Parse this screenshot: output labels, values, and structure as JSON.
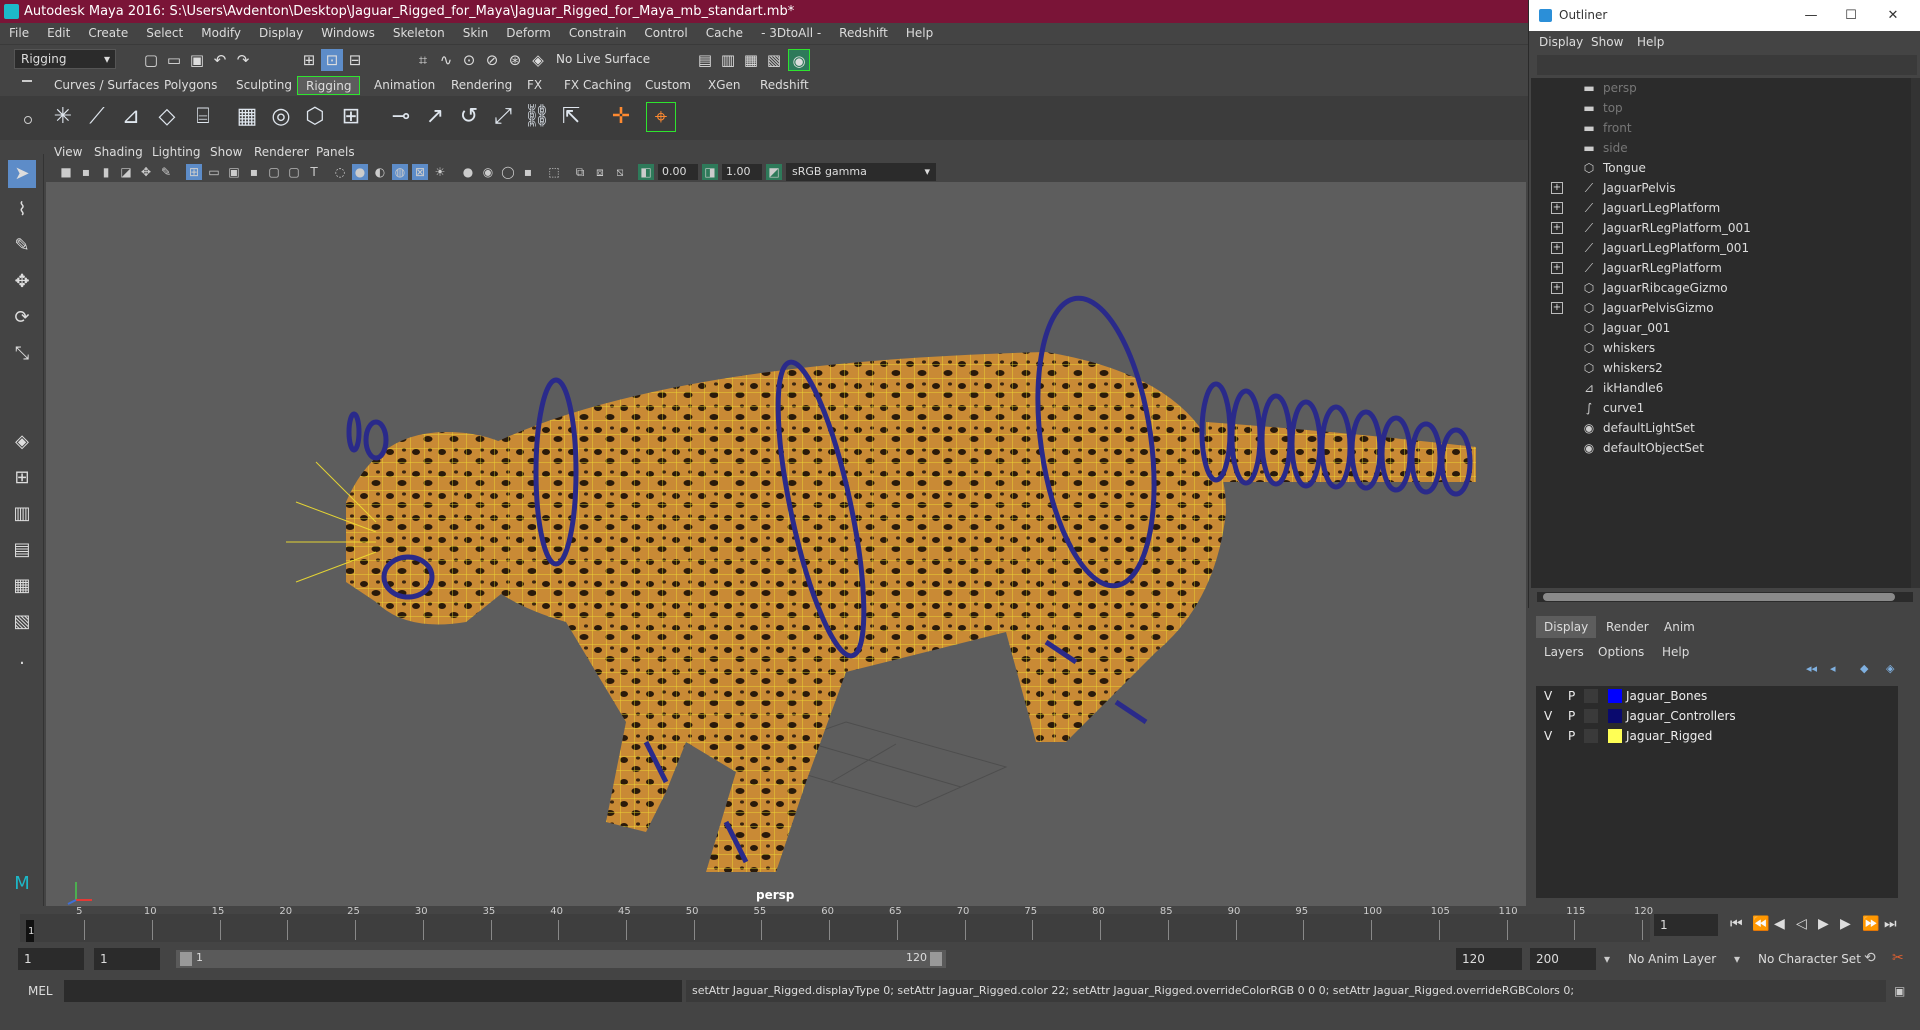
{
  "window": {
    "title": "Autodesk Maya 2016: S:\\Users\\Avdenton\\Desktop\\Jaguar_Rigged_for_Maya\\Jaguar_Rigged_for_Maya_mb_standart.mb*"
  },
  "menubar": [
    "File",
    "Edit",
    "Create",
    "Select",
    "Modify",
    "Display",
    "Windows",
    "Skeleton",
    "Skin",
    "Deform",
    "Constrain",
    "Control",
    "Cache",
    "- 3DtoAll -",
    "Redshift",
    "Help"
  ],
  "statusline": {
    "menuset": "Rigging",
    "live_surface": "No Live Surface"
  },
  "shelf_tabs": [
    "Curves / Surfaces",
    "Polygons",
    "Sculpting",
    "Rigging",
    "Animation",
    "Rendering",
    "FX",
    "FX Caching",
    "Custom",
    "XGen",
    "Redshift"
  ],
  "shelf_active": "Rigging",
  "panel_menu": [
    "View",
    "Shading",
    "Lighting",
    "Show",
    "Renderer",
    "Panels"
  ],
  "panel_toolbar": {
    "exposure": "0.00",
    "gamma": "1.00",
    "color_space": "sRGB gamma"
  },
  "viewport": {
    "camera_label": "persp"
  },
  "timeline": {
    "ticks": [
      "5",
      "10",
      "15",
      "20",
      "25",
      "30",
      "35",
      "40",
      "45",
      "50",
      "55",
      "60",
      "65",
      "70",
      "75",
      "80",
      "85",
      "90",
      "95",
      "100",
      "105",
      "110",
      "115",
      "120"
    ],
    "start_marker": "1",
    "current_frame": "1"
  },
  "range": {
    "start": "1",
    "anim_start": "1",
    "slider_start": "1",
    "slider_end": "120",
    "anim_end": "120",
    "end": "200",
    "anim_layer": "No Anim Layer",
    "character_set": "No Character Set"
  },
  "command": {
    "lang": "MEL",
    "result": "setAttr Jaguar_Rigged.displayType 0; setAttr Jaguar_Rigged.color 22; setAttr Jaguar_Rigged.overrideColorRGB 0 0 0; setAttr Jaguar_Rigged.overrideRGBColors 0;"
  },
  "outliner": {
    "title": "Outliner",
    "menu": [
      "Display",
      "Show",
      "Help"
    ],
    "items": [
      {
        "label": "persp",
        "icon": "camera-icon",
        "expandable": false,
        "dim": true
      },
      {
        "label": "top",
        "icon": "camera-icon",
        "expandable": false,
        "dim": true
      },
      {
        "label": "front",
        "icon": "camera-icon",
        "expandable": false,
        "dim": true
      },
      {
        "label": "side",
        "icon": "camera-icon",
        "expandable": false,
        "dim": true
      },
      {
        "label": "Tongue",
        "icon": "mesh-icon",
        "expandable": false,
        "dim": false
      },
      {
        "label": "JaguarPelvis",
        "icon": "joint-icon",
        "expandable": true,
        "dim": false
      },
      {
        "label": "JaguarLLegPlatform",
        "icon": "joint-icon",
        "expandable": true,
        "dim": false
      },
      {
        "label": "JaguarRLegPlatform_001",
        "icon": "joint-icon",
        "expandable": true,
        "dim": false
      },
      {
        "label": "JaguarLLegPlatform_001",
        "icon": "joint-icon",
        "expandable": true,
        "dim": false
      },
      {
        "label": "JaguarRLegPlatform",
        "icon": "joint-icon",
        "expandable": true,
        "dim": false
      },
      {
        "label": "JaguarRibcageGizmo",
        "icon": "mesh-icon",
        "expandable": true,
        "dim": false
      },
      {
        "label": "JaguarPelvisGizmo",
        "icon": "mesh-icon",
        "expandable": true,
        "dim": false
      },
      {
        "label": "Jaguar_001",
        "icon": "mesh-icon",
        "expandable": false,
        "dim": false
      },
      {
        "label": "whiskers",
        "icon": "mesh-icon",
        "expandable": false,
        "dim": false
      },
      {
        "label": "whiskers2",
        "icon": "mesh-icon",
        "expandable": false,
        "dim": false
      },
      {
        "label": "ikHandle6",
        "icon": "ikhandle-icon",
        "expandable": false,
        "dim": false
      },
      {
        "label": "curve1",
        "icon": "curve-icon",
        "expandable": false,
        "dim": false
      },
      {
        "label": "defaultLightSet",
        "icon": "set-icon",
        "expandable": false,
        "dim": false
      },
      {
        "label": "defaultObjectSet",
        "icon": "set-icon",
        "expandable": false,
        "dim": false
      }
    ]
  },
  "layer_editor": {
    "tabs": [
      "Display",
      "Render",
      "Anim"
    ],
    "menu": [
      "Layers",
      "Options",
      "Help"
    ],
    "layers": [
      {
        "v": "V",
        "p": "P",
        "name": "Jaguar_Bones",
        "color": "#0000ff"
      },
      {
        "v": "V",
        "p": "P",
        "name": "Jaguar_Controllers",
        "color": "#0a0a6e"
      },
      {
        "v": "V",
        "p": "P",
        "name": "Jaguar_Rigged",
        "color": "#ffff55"
      }
    ]
  }
}
